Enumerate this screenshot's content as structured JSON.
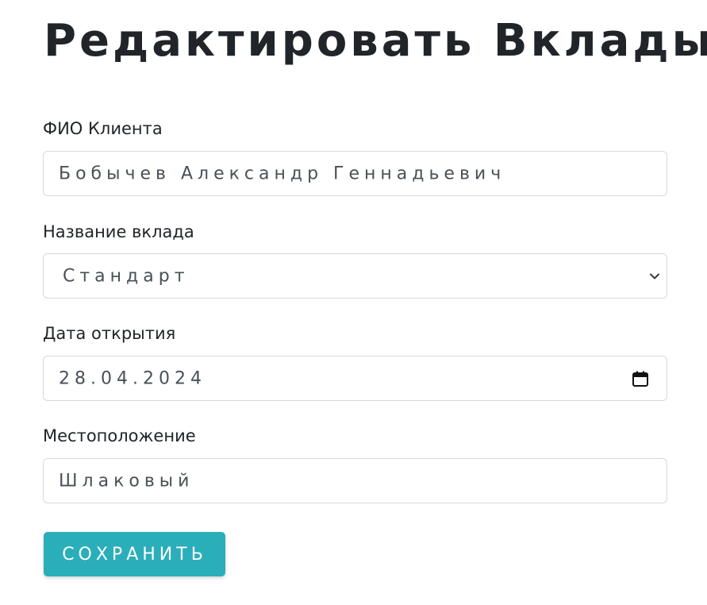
{
  "page": {
    "title": "Редактировать Вклады"
  },
  "form": {
    "client": {
      "label": "ФИО Клиента",
      "value": "Бобычев Александр Геннадьевич"
    },
    "deposit": {
      "label": "Название вклада",
      "selected": "Стандарт",
      "icon": "chevron-down-icon"
    },
    "date": {
      "label": "Дата открытия",
      "value": "28.04.2024",
      "icon": "calendar-icon"
    },
    "location": {
      "label": "Местоположение",
      "value": "Шлаковый"
    },
    "save_label": "СОХРАНИТЬ"
  },
  "colors": {
    "button": "#2aaeba",
    "border": "#d6d9dd",
    "text": "#212529"
  }
}
